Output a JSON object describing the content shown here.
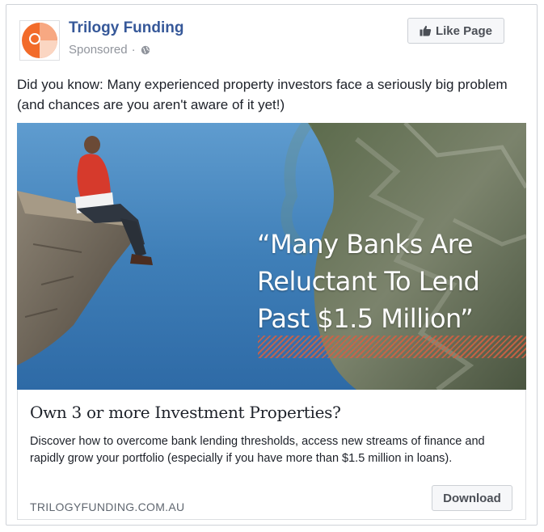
{
  "post": {
    "page_name": "Trilogy Funding",
    "sponsored_label": "Sponsored",
    "separator": "·",
    "like_button_label": "Like Page",
    "body_text": "Did you know: Many experienced property investors face a seriously big problem (and chances are you aren't aware of it yet!)"
  },
  "ad": {
    "image_quote_line1": "“Many Banks Are",
    "image_quote_line2": "Reluctant To Lend",
    "image_quote_line3": "Past $1.5 Million”",
    "headline": "Own 3 or more Investment Properties?",
    "description": "Discover how to overcome bank lending thresholds, access new streams of finance and rapidly grow your portfolio (especially if you have more than $1.5 million in loans).",
    "display_url": "TRILOGYFUNDING.COM.AU",
    "cta_label": "Download"
  },
  "icons": {
    "logo": "trilogy-funding-logo",
    "audience": "globe-icon",
    "like": "thumbs-up-icon"
  },
  "colors": {
    "page_name": "#365899",
    "logo_orange": "#f26b2a",
    "stripe_accent": "#d66042"
  }
}
